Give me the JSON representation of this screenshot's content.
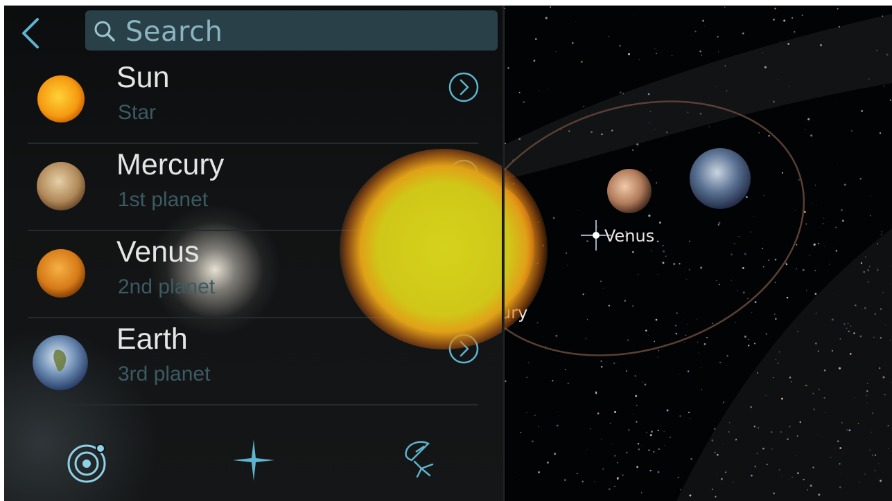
{
  "search": {
    "placeholder": "Search"
  },
  "objects": [
    {
      "name": "Sun",
      "subtitle": "Star",
      "icon": "sun-thumbnail"
    },
    {
      "name": "Mercury",
      "subtitle": "1st planet",
      "icon": "mercury-thumbnail"
    },
    {
      "name": "Venus",
      "subtitle": "2nd planet",
      "icon": "venus-thumbnail"
    },
    {
      "name": "Earth",
      "subtitle": "3rd planet",
      "icon": "earth-thumbnail"
    }
  ],
  "tabs": [
    {
      "icon": "solar-system-icon"
    },
    {
      "icon": "star-icon"
    },
    {
      "icon": "satellite-dish-icon"
    }
  ],
  "space_view": {
    "labels": {
      "venus": "Venus",
      "mercury_partial": "ury"
    }
  },
  "colors": {
    "accent": "#5fb4cf",
    "subtitle": "#3c5a62",
    "search_bg": "#2a4048"
  }
}
